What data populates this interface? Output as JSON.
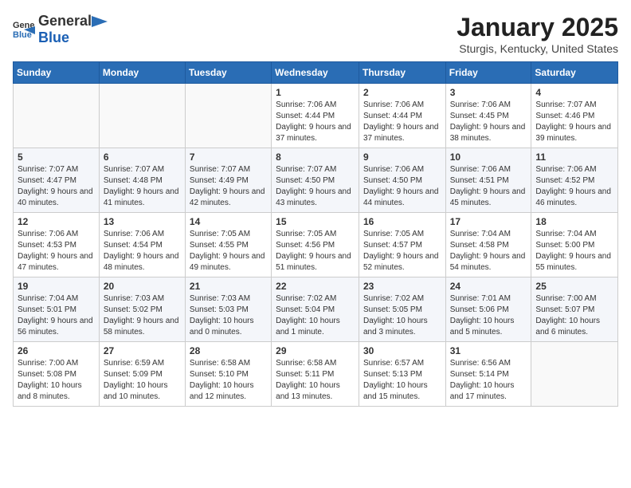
{
  "header": {
    "logo_general": "General",
    "logo_blue": "Blue",
    "title": "January 2025",
    "subtitle": "Sturgis, Kentucky, United States"
  },
  "weekdays": [
    "Sunday",
    "Monday",
    "Tuesday",
    "Wednesday",
    "Thursday",
    "Friday",
    "Saturday"
  ],
  "weeks": [
    [
      {
        "day": "",
        "info": ""
      },
      {
        "day": "",
        "info": ""
      },
      {
        "day": "",
        "info": ""
      },
      {
        "day": "1",
        "info": "Sunrise: 7:06 AM\nSunset: 4:44 PM\nDaylight: 9 hours and 37 minutes."
      },
      {
        "day": "2",
        "info": "Sunrise: 7:06 AM\nSunset: 4:44 PM\nDaylight: 9 hours and 37 minutes."
      },
      {
        "day": "3",
        "info": "Sunrise: 7:06 AM\nSunset: 4:45 PM\nDaylight: 9 hours and 38 minutes."
      },
      {
        "day": "4",
        "info": "Sunrise: 7:07 AM\nSunset: 4:46 PM\nDaylight: 9 hours and 39 minutes."
      }
    ],
    [
      {
        "day": "5",
        "info": "Sunrise: 7:07 AM\nSunset: 4:47 PM\nDaylight: 9 hours and 40 minutes."
      },
      {
        "day": "6",
        "info": "Sunrise: 7:07 AM\nSunset: 4:48 PM\nDaylight: 9 hours and 41 minutes."
      },
      {
        "day": "7",
        "info": "Sunrise: 7:07 AM\nSunset: 4:49 PM\nDaylight: 9 hours and 42 minutes."
      },
      {
        "day": "8",
        "info": "Sunrise: 7:07 AM\nSunset: 4:50 PM\nDaylight: 9 hours and 43 minutes."
      },
      {
        "day": "9",
        "info": "Sunrise: 7:06 AM\nSunset: 4:50 PM\nDaylight: 9 hours and 44 minutes."
      },
      {
        "day": "10",
        "info": "Sunrise: 7:06 AM\nSunset: 4:51 PM\nDaylight: 9 hours and 45 minutes."
      },
      {
        "day": "11",
        "info": "Sunrise: 7:06 AM\nSunset: 4:52 PM\nDaylight: 9 hours and 46 minutes."
      }
    ],
    [
      {
        "day": "12",
        "info": "Sunrise: 7:06 AM\nSunset: 4:53 PM\nDaylight: 9 hours and 47 minutes."
      },
      {
        "day": "13",
        "info": "Sunrise: 7:06 AM\nSunset: 4:54 PM\nDaylight: 9 hours and 48 minutes."
      },
      {
        "day": "14",
        "info": "Sunrise: 7:05 AM\nSunset: 4:55 PM\nDaylight: 9 hours and 49 minutes."
      },
      {
        "day": "15",
        "info": "Sunrise: 7:05 AM\nSunset: 4:56 PM\nDaylight: 9 hours and 51 minutes."
      },
      {
        "day": "16",
        "info": "Sunrise: 7:05 AM\nSunset: 4:57 PM\nDaylight: 9 hours and 52 minutes."
      },
      {
        "day": "17",
        "info": "Sunrise: 7:04 AM\nSunset: 4:58 PM\nDaylight: 9 hours and 54 minutes."
      },
      {
        "day": "18",
        "info": "Sunrise: 7:04 AM\nSunset: 5:00 PM\nDaylight: 9 hours and 55 minutes."
      }
    ],
    [
      {
        "day": "19",
        "info": "Sunrise: 7:04 AM\nSunset: 5:01 PM\nDaylight: 9 hours and 56 minutes."
      },
      {
        "day": "20",
        "info": "Sunrise: 7:03 AM\nSunset: 5:02 PM\nDaylight: 9 hours and 58 minutes."
      },
      {
        "day": "21",
        "info": "Sunrise: 7:03 AM\nSunset: 5:03 PM\nDaylight: 10 hours and 0 minutes."
      },
      {
        "day": "22",
        "info": "Sunrise: 7:02 AM\nSunset: 5:04 PM\nDaylight: 10 hours and 1 minute."
      },
      {
        "day": "23",
        "info": "Sunrise: 7:02 AM\nSunset: 5:05 PM\nDaylight: 10 hours and 3 minutes."
      },
      {
        "day": "24",
        "info": "Sunrise: 7:01 AM\nSunset: 5:06 PM\nDaylight: 10 hours and 5 minutes."
      },
      {
        "day": "25",
        "info": "Sunrise: 7:00 AM\nSunset: 5:07 PM\nDaylight: 10 hours and 6 minutes."
      }
    ],
    [
      {
        "day": "26",
        "info": "Sunrise: 7:00 AM\nSunset: 5:08 PM\nDaylight: 10 hours and 8 minutes."
      },
      {
        "day": "27",
        "info": "Sunrise: 6:59 AM\nSunset: 5:09 PM\nDaylight: 10 hours and 10 minutes."
      },
      {
        "day": "28",
        "info": "Sunrise: 6:58 AM\nSunset: 5:10 PM\nDaylight: 10 hours and 12 minutes."
      },
      {
        "day": "29",
        "info": "Sunrise: 6:58 AM\nSunset: 5:11 PM\nDaylight: 10 hours and 13 minutes."
      },
      {
        "day": "30",
        "info": "Sunrise: 6:57 AM\nSunset: 5:13 PM\nDaylight: 10 hours and 15 minutes."
      },
      {
        "day": "31",
        "info": "Sunrise: 6:56 AM\nSunset: 5:14 PM\nDaylight: 10 hours and 17 minutes."
      },
      {
        "day": "",
        "info": ""
      }
    ]
  ]
}
